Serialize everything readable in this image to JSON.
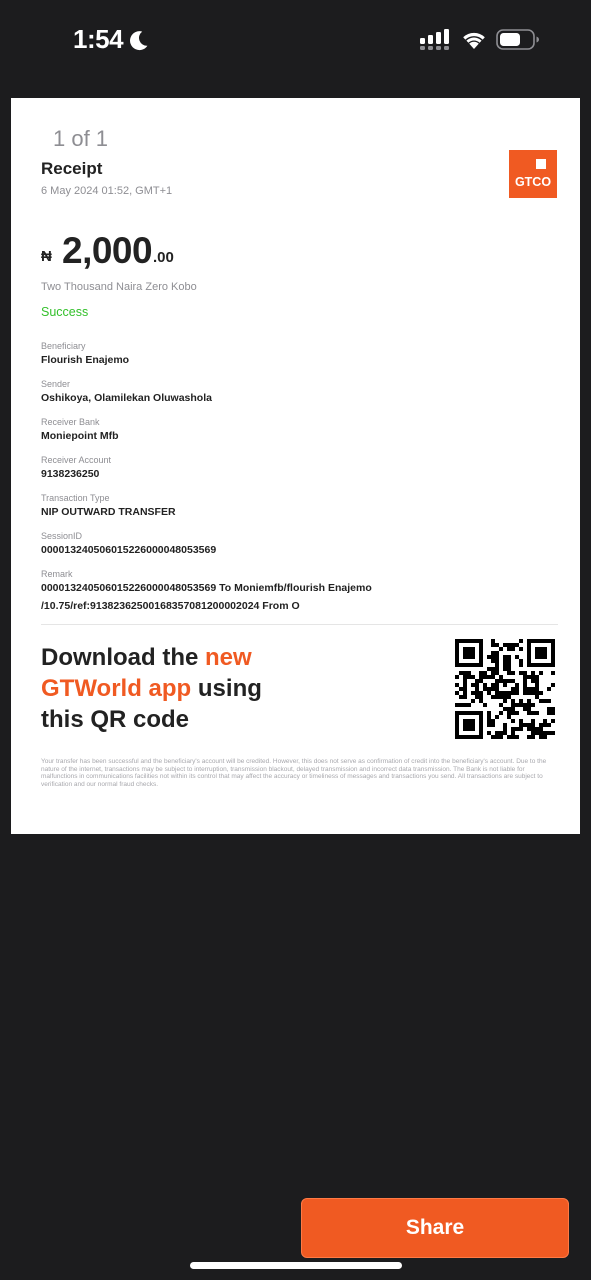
{
  "status_bar": {
    "time": "1:54",
    "icons": [
      "moon-icon",
      "signal-icon",
      "wifi-icon",
      "battery-icon"
    ]
  },
  "receipt": {
    "pager": "1 of 1",
    "title": "Receipt",
    "date": "6 May 2024 01:52, GMT+1",
    "logo_text": "GTCO",
    "currency_symbol": "₦",
    "amount_whole": "2,000",
    "amount_decimal": ".00",
    "amount_words": "Two Thousand Naira Zero Kobo",
    "status": "Success",
    "fields": {
      "beneficiary": {
        "label": "Beneficiary",
        "value": "Flourish Enajemo"
      },
      "sender": {
        "label": "Sender",
        "value": "Oshikoya, Olamilekan Oluwashola"
      },
      "receiver_bank": {
        "label": "Receiver Bank",
        "value": "Moniepoint Mfb"
      },
      "receiver_account": {
        "label": "Receiver Account",
        "value": "9138236250"
      },
      "transaction_type": {
        "label": "Transaction Type",
        "value": "NIP OUTWARD TRANSFER"
      },
      "session_id": {
        "label": "SessionID",
        "value": "000013240506015226000048053569"
      },
      "remark": {
        "label": "Remark",
        "line1": "000013240506015226000048053569 To Moniemfb/flourish Enajemo",
        "line2": "/10.75/ref:91382362500168357081200002024 From O"
      }
    },
    "promo": {
      "part1": "Download the ",
      "accent1": "new",
      "accent2": "GTWorld app",
      "part2": " using",
      "line3": "this QR code"
    },
    "disclaimer": "Your transfer has been successful and the beneficiary's account will be credited. However, this does not serve as confirmation of credit into the beneficiary's account. Due to the nature of the internet, transactions may be subject to interruption, transmission blackout, delayed transmission and incorrect data transmission. The Bank is not liable for malfunctions in communications facilities not within its control that may affect the accuracy or timeliness of messages and transactions you send. All transactions are subject to verification and our normal fraud checks."
  },
  "actions": {
    "share_label": "Share"
  },
  "colors": {
    "brand": "#f05a22",
    "success": "#34c02c",
    "background": "#1c1c1e"
  }
}
